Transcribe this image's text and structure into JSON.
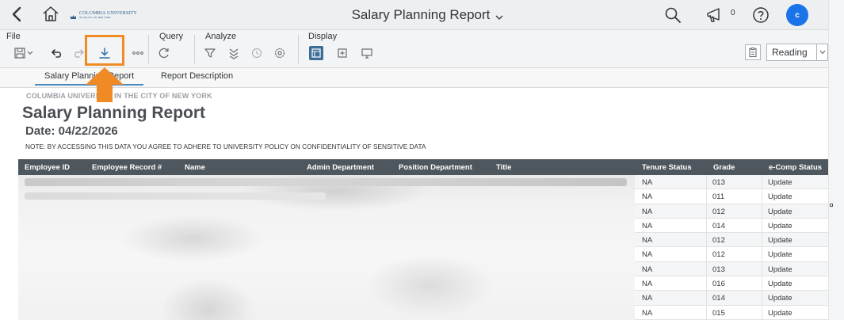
{
  "shell": {
    "logo_text": "COLUMBIA UNIVERSITY",
    "logo_subtext": "IN THE CITY OF NEW YORK",
    "title": "Salary Planning Report",
    "notification_count": "0",
    "avatar_initial": "c"
  },
  "toolbar": {
    "groups": {
      "file": "File",
      "query": "Query",
      "analyze": "Analyze",
      "display": "Display"
    },
    "reading_mode": "Reading"
  },
  "tabs": [
    {
      "label": "Salary Planning Report",
      "active": true
    },
    {
      "label": "Report Description",
      "active": false
    }
  ],
  "report": {
    "subheading": "COLUMBIA UNIVERSITY IN THE CITY OF NEW YORK",
    "title": "Salary Planning Report",
    "date": "Date: 04/22/2026",
    "note": "NOTE: BY ACCESSING THIS DATA YOU AGREE TO ADHERE TO UNIVERSITY POLICY ON CONFIDENTIALITY OF SENSITIVE DATA"
  },
  "table": {
    "columns": [
      "Employee ID",
      "Employee Record #",
      "Name",
      "Admin Department",
      "Position Department",
      "Title",
      "Tenure Status",
      "Grade",
      "e-Comp Status"
    ],
    "rows": [
      {
        "tenure": "NA",
        "grade": "013",
        "ecomp": "Update"
      },
      {
        "tenure": "NA",
        "grade": "011",
        "ecomp": "Update"
      },
      {
        "tenure": "NA",
        "grade": "012",
        "ecomp": "Update"
      },
      {
        "tenure": "NA",
        "grade": "014",
        "ecomp": "Update"
      },
      {
        "tenure": "NA",
        "grade": "012",
        "ecomp": "Update"
      },
      {
        "tenure": "NA",
        "grade": "012",
        "ecomp": "Update"
      },
      {
        "tenure": "NA",
        "grade": "013",
        "ecomp": "Update"
      },
      {
        "tenure": "NA",
        "grade": "016",
        "ecomp": "Update"
      },
      {
        "tenure": "NA",
        "grade": "014",
        "ecomp": "Update"
      },
      {
        "tenure": "NA",
        "grade": "015",
        "ecomp": "Update"
      }
    ]
  },
  "colors": {
    "accent": "#1a73e8",
    "highlight": "#f08a24",
    "table_header": "#4f575e"
  }
}
